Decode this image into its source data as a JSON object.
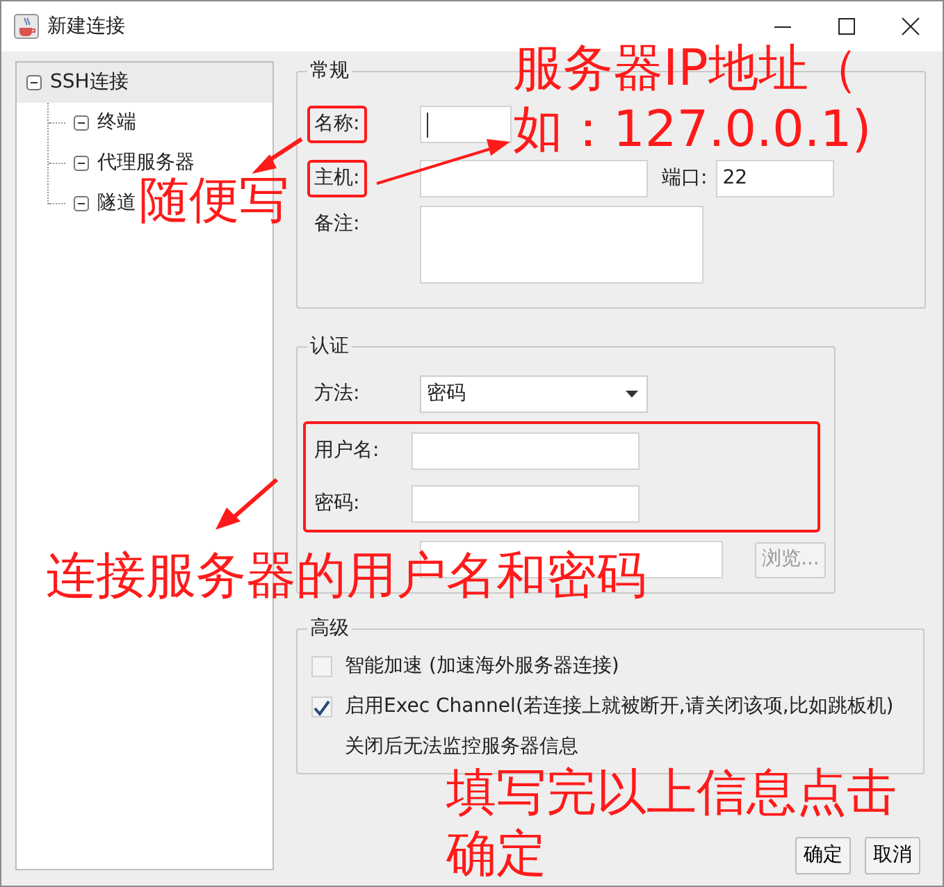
{
  "window": {
    "title": "新建连接"
  },
  "tree": [
    {
      "label": "SSH连接",
      "selected": true,
      "expanded": true,
      "children": [
        {
          "label": "终端",
          "expanded": true
        },
        {
          "label": "代理服务器",
          "expanded": true
        },
        {
          "label": "隧道",
          "expanded": true
        }
      ]
    }
  ],
  "general": {
    "title": "常规",
    "joint_highlight": false,
    "fields": [
      {
        "kind": "text",
        "label": "名称:",
        "focused": true,
        "highlighted": true
      },
      {
        "kind": "text",
        "label": "主机:",
        "highlighted": true,
        "side": {
          "label": "端口:",
          "value": "22"
        }
      },
      {
        "kind": "textarea",
        "label": "备注:"
      }
    ]
  },
  "auth": {
    "title": "认证",
    "joint_highlight": true,
    "fields": [
      {
        "kind": "select",
        "label": "方法:",
        "value": "密码"
      },
      {
        "kind": "text",
        "label": "用户名:",
        "highlighted": true
      },
      {
        "kind": "text",
        "label": "密码:",
        "highlighted": true
      },
      {
        "kind": "file",
        "button": "浏览...",
        "disabled": true
      }
    ]
  },
  "advanced": {
    "title": "高级",
    "options": [
      {
        "kind": "checkbox",
        "label": "智能加速 (加速海外服务器连接)",
        "checked": false
      },
      {
        "kind": "checkbox",
        "label": "启用Exec Channel(若连接上就被断开,请关闭该项,比如跳板机)",
        "checked": true
      },
      {
        "kind": "note",
        "label": "关闭后无法监控服务器信息"
      }
    ]
  },
  "buttons": [
    "确定",
    "取消"
  ],
  "annotations": [
    {
      "text": "随便写"
    },
    {
      "text": "服务器IP地址（如：127.0.0.1)"
    },
    {
      "text": "连接服务器的用户名和密码"
    },
    {
      "text": "填写完以上信息点击"
    },
    {
      "text": "确定"
    }
  ]
}
